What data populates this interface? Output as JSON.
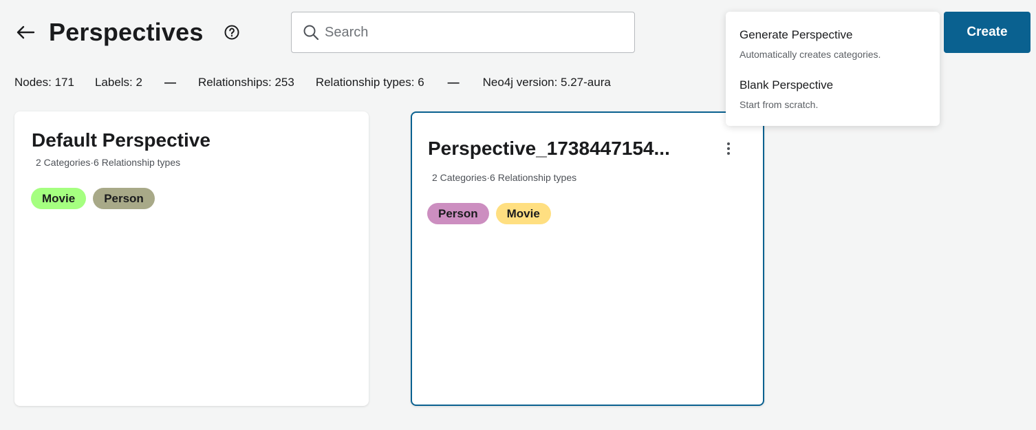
{
  "header": {
    "back_icon": "arrow-left-icon",
    "title": "Perspectives",
    "help_icon": "question-circle-icon",
    "search": {
      "icon": "search-icon",
      "placeholder": "Search",
      "value": ""
    },
    "create_label": "Create"
  },
  "stats": {
    "nodes": "Nodes: 171",
    "labels": "Labels: 2",
    "separator": "—",
    "relationships": "Relationships: 253",
    "relationship_types": "Relationship types: 6",
    "neo4j_version": "Neo4j version: 5.27-aura"
  },
  "dropdown": {
    "items": [
      {
        "label": "Generate Perspective",
        "description": "Automatically creates categories."
      },
      {
        "label": "Blank Perspective",
        "description": "Start from scratch."
      }
    ]
  },
  "cards": [
    {
      "title": "Default Perspective",
      "subtitle": "2 Categories·6 Relationship types",
      "tags": [
        {
          "label": "Movie",
          "color": "#a5ff80"
        },
        {
          "label": "Person",
          "color": "#a8a988"
        }
      ],
      "selected": false
    },
    {
      "title": "Perspective_1738447154...",
      "subtitle": "2 Categories·6 Relationship types",
      "menu_icon": "more-vertical-icon",
      "tags": [
        {
          "label": "Person",
          "color": "#cc8ec0"
        },
        {
          "label": "Movie",
          "color": "#ffdf81"
        }
      ],
      "selected": true
    }
  ],
  "colors": {
    "accent": "#0a6190",
    "background": "#f4f5f5"
  }
}
